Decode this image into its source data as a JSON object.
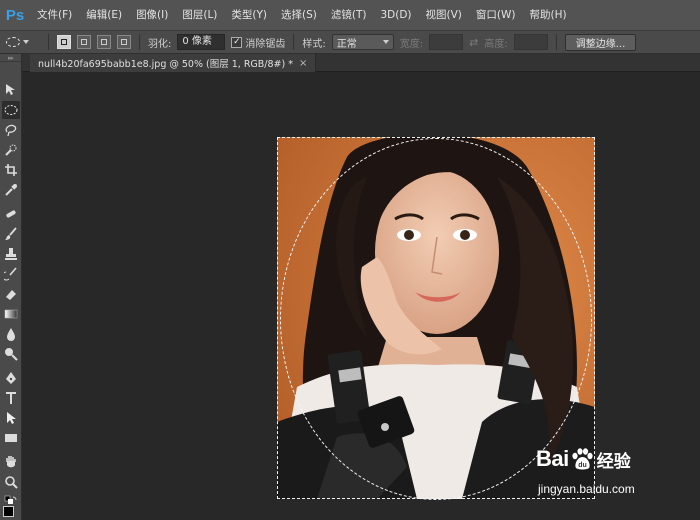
{
  "app": {
    "logo": "Ps"
  },
  "menu": [
    "文件(F)",
    "编辑(E)",
    "图像(I)",
    "图层(L)",
    "类型(Y)",
    "选择(S)",
    "滤镜(T)",
    "3D(D)",
    "视图(V)",
    "窗口(W)",
    "帮助(H)"
  ],
  "options": {
    "feather_label": "羽化:",
    "feather_value": "0 像素",
    "antialias_label": "消除锯齿",
    "antialias_checked": true,
    "style_label": "样式:",
    "style_value": "正常",
    "width_label": "宽度:",
    "height_label": "高度:",
    "refine_edge_label": "调整边缘..."
  },
  "document_tab": {
    "title": "null4b20fa695babb1e8.jpg @ 50% (图层 1, RGB/8#) *",
    "close": "×"
  },
  "tools": [
    "move-tool",
    "elliptical-marquee-tool",
    "lasso-tool",
    "quick-selection-tool",
    "crop-tool",
    "eyedropper-tool",
    "spot-healing-tool",
    "brush-tool",
    "clone-stamp-tool",
    "history-brush-tool",
    "eraser-tool",
    "gradient-tool",
    "blur-tool",
    "dodge-tool",
    "pen-tool",
    "type-tool",
    "path-selection-tool",
    "rectangle-tool",
    "hand-tool",
    "zoom-tool"
  ],
  "watermark": {
    "brand": "Bai",
    "brand_suffix": "经验",
    "url": "jingyan.baidu.com"
  },
  "colors": {
    "menubar": "#535353",
    "canvas": "#282828",
    "accent": "#3aa0e8",
    "photo_background": "#c9743a"
  }
}
